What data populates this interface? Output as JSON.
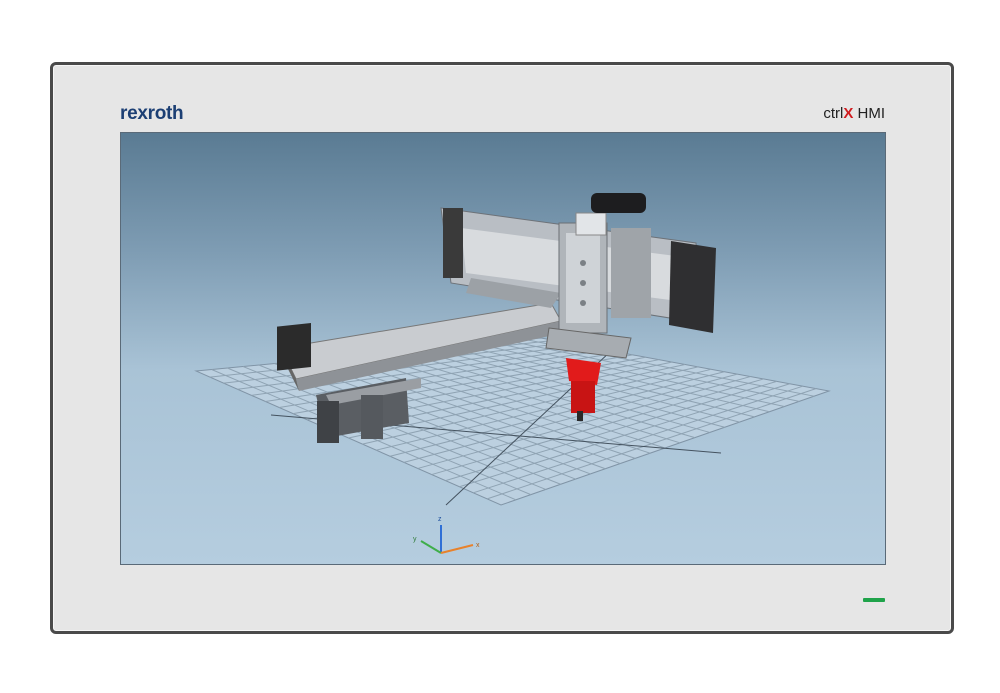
{
  "bezel": {
    "brand": {
      "text": "rexroth",
      "accent": "#c8102e",
      "color": "#1c3f74"
    },
    "model": {
      "prefix": "ctrl",
      "x": "X",
      "suffix": " HMI"
    },
    "led": {
      "color": "#1fa34a",
      "state": "on"
    }
  },
  "viewport": {
    "scene": "3d-gantry-robot",
    "gripper_color": "#e11b1b",
    "axes": {
      "z": "z",
      "y": "y",
      "x": "x"
    }
  }
}
